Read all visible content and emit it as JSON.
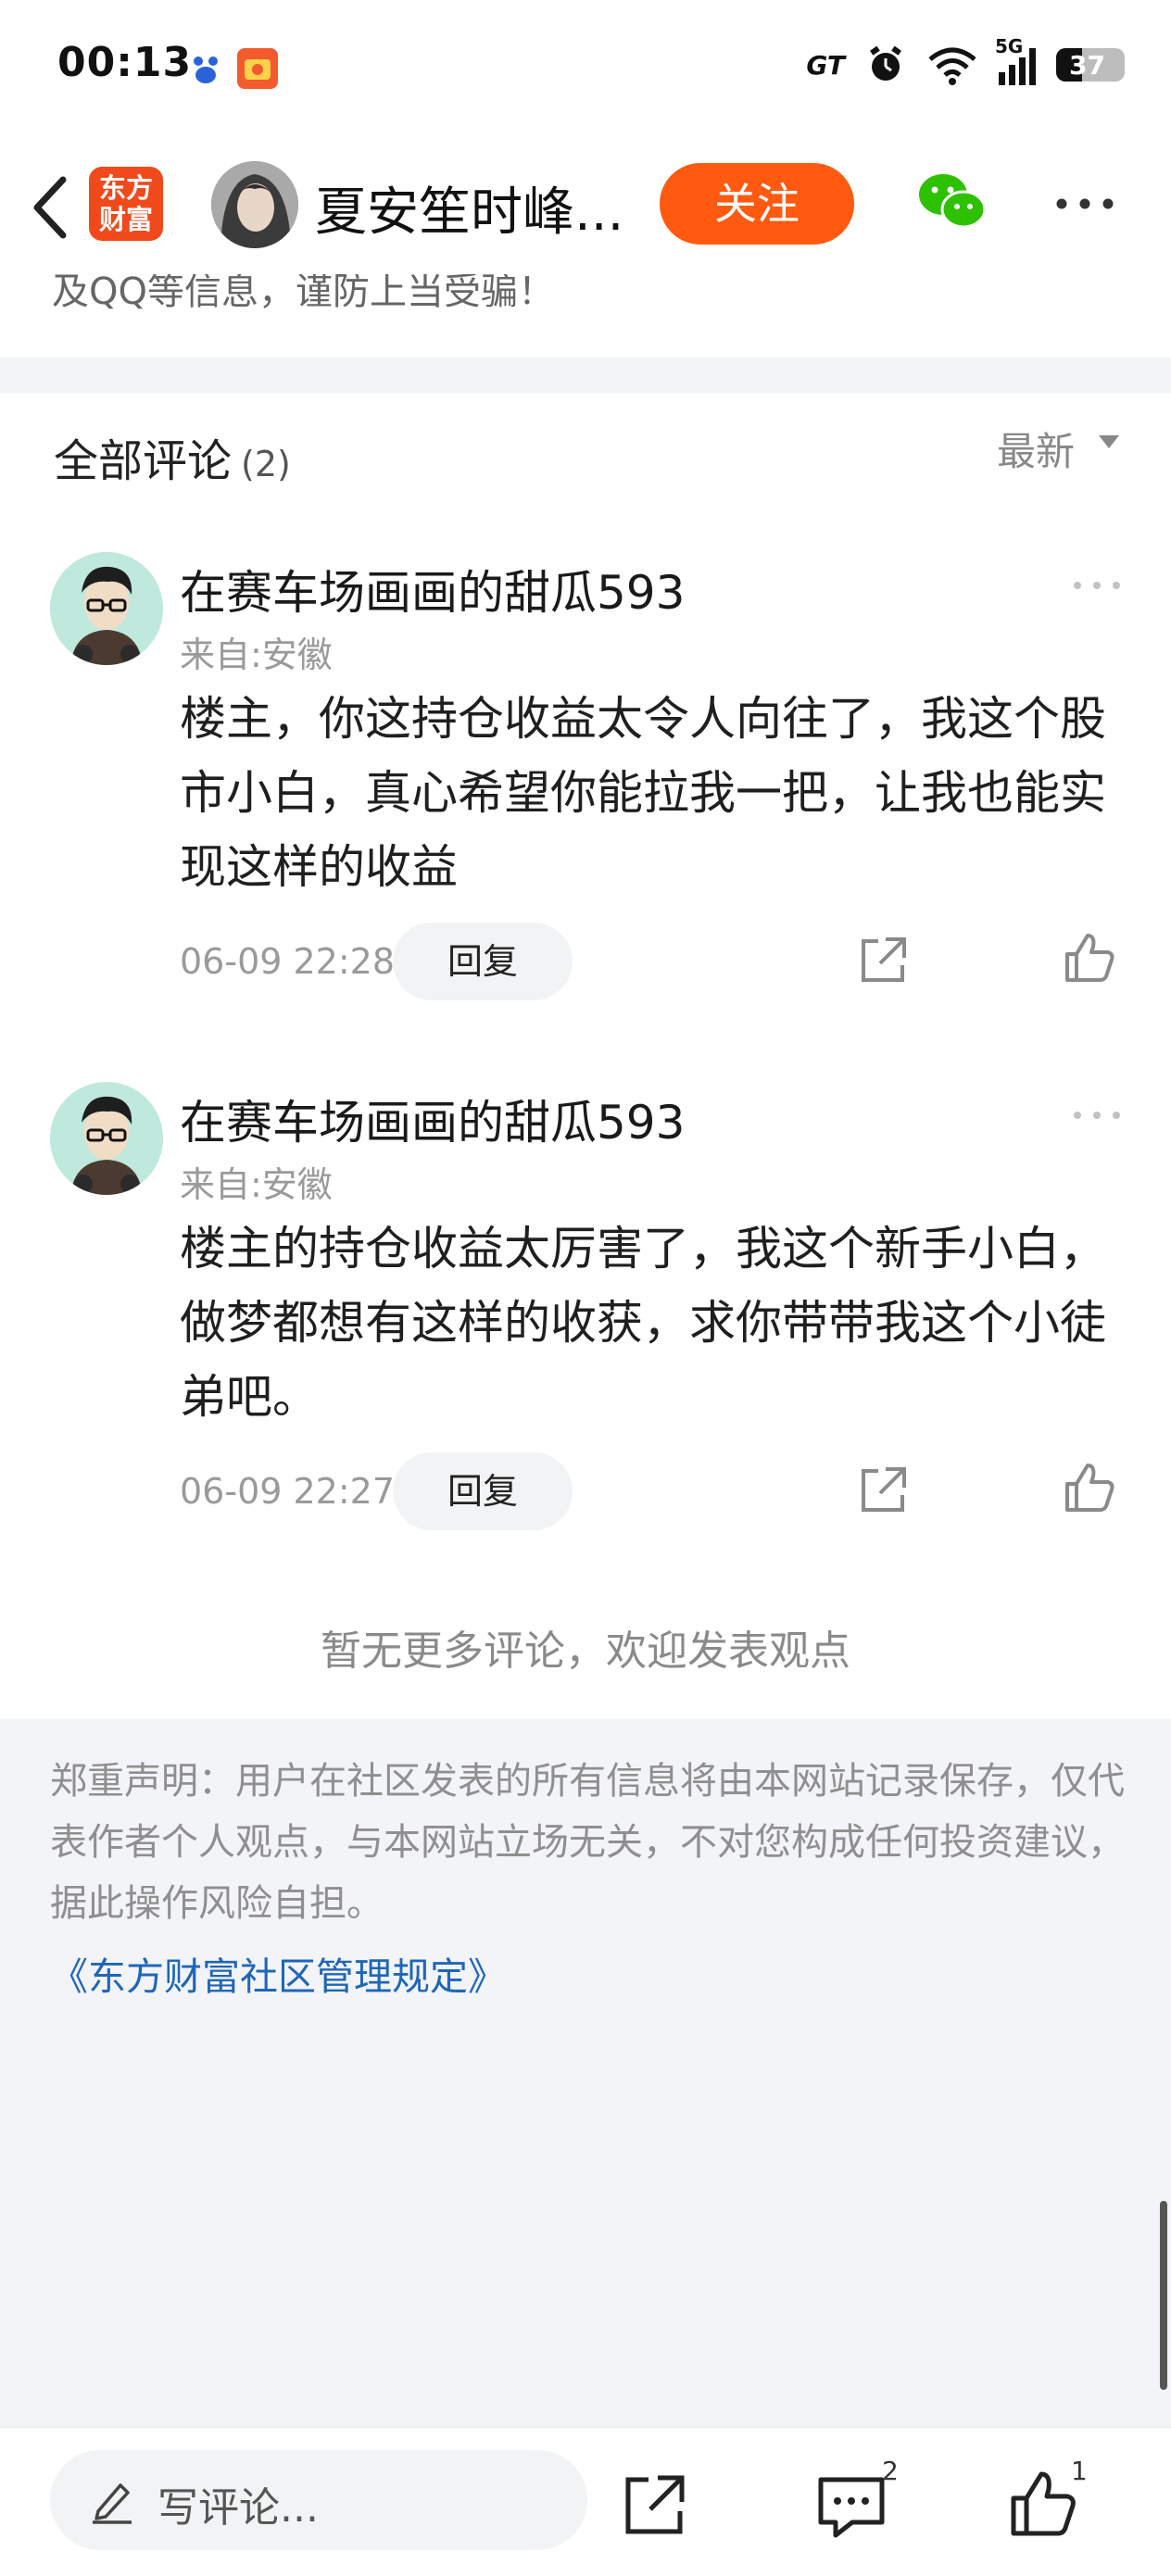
{
  "status_bar": {
    "time": "00:13",
    "battery": "37",
    "network": "5G"
  },
  "header": {
    "app_logo_line1": "东方",
    "app_logo_line2": "财富",
    "author_name": "夏安笙时峰...",
    "follow_label": "关注"
  },
  "article": {
    "clipped_text": "及QQ等信息，谨防上当受骗！"
  },
  "comments_section": {
    "title": "全部评论",
    "count": "(2)",
    "sort_label": "最新",
    "items": [
      {
        "user": "在赛车场画画的甜瓜593",
        "location": "来自:安徽",
        "text": "楼主，你这持仓收益太令人向往了，我这个股市小白，真心希望你能拉我一把，让我也能实现这样的收益",
        "time": "06-09 22:28",
        "reply_label": "回复"
      },
      {
        "user": "在赛车场画画的甜瓜593",
        "location": "来自:安徽",
        "text": "楼主的持仓收益太厉害了，我这个新手小白，做梦都想有这样的收获，求你带带我这个小徒弟吧。",
        "time": "06-09 22:27",
        "reply_label": "回复"
      }
    ],
    "no_more": "暂无更多评论，欢迎发表观点"
  },
  "disclaimer": {
    "text": "郑重声明：用户在社区发表的所有信息将由本网站记录保存，仅代表作者个人观点，与本网站立场无关，不对您构成任何投资建议，据此操作风险自担。",
    "link": "《东方财富社区管理规定》"
  },
  "bottom_bar": {
    "input_placeholder": "写评论...",
    "comment_count": "2",
    "like_count": "1"
  },
  "colors": {
    "accent": "#ff5a10",
    "link": "#1f66b8",
    "background_gray": "#f3f4f7"
  }
}
